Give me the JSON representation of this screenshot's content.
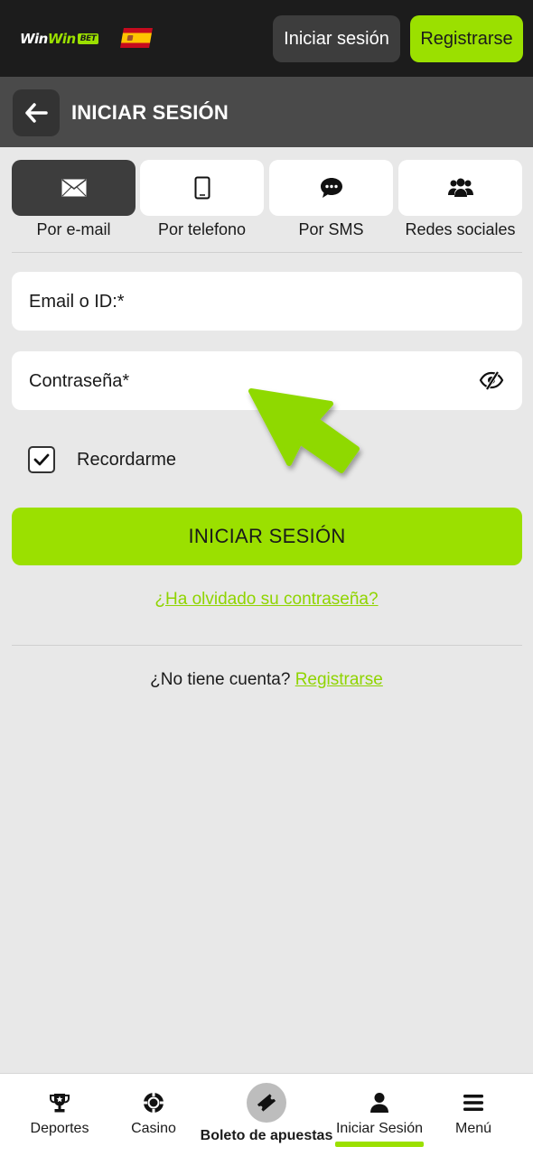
{
  "header": {
    "logo_part1": "Win",
    "logo_part2": "Win",
    "logo_badge": "BET",
    "login_label": "Iniciar sesión",
    "register_label": "Registrarse"
  },
  "titlebar": {
    "title": "INICIAR SESIÓN"
  },
  "tabs": [
    {
      "label": "Por e-mail",
      "icon": "envelope-icon",
      "active": true
    },
    {
      "label": "Por telefono",
      "icon": "phone-icon",
      "active": false
    },
    {
      "label": "Por SMS",
      "icon": "chat-bubble-icon",
      "active": false
    },
    {
      "label": "Redes sociales",
      "icon": "users-icon",
      "active": false
    }
  ],
  "form": {
    "email_label": "Email o ID:*",
    "password_label": "Contraseña*",
    "remember_label": "Recordarme",
    "remember_checked": true,
    "submit_label": "INICIAR SESIÓN",
    "forgot_label": "¿Ha olvidado su contraseña?",
    "no_account_text": "¿No tiene cuenta?",
    "register_link": "Registrarse"
  },
  "bottom_nav": [
    {
      "label": "Deportes",
      "icon": "trophy-icon"
    },
    {
      "label": "Casino",
      "icon": "casino-chip-icon"
    },
    {
      "label": "Boleto de apuestas",
      "icon": "ticket-icon"
    },
    {
      "label": "Iniciar Sesión",
      "icon": "user-icon",
      "active": true
    },
    {
      "label": "Menú",
      "icon": "hamburger-menu-icon"
    }
  ],
  "colors": {
    "accent": "#9be000",
    "header_bg": "#1c1c1c",
    "titlebar_bg": "#4a4a4a",
    "page_bg": "#e8e8e8"
  }
}
